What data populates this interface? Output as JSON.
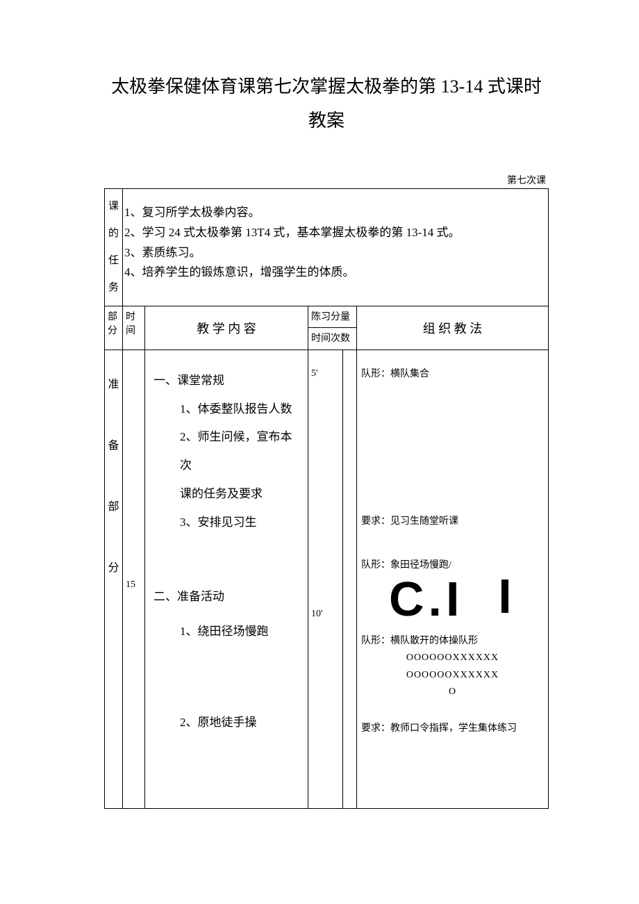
{
  "title": "太极拳保健体育课第七次掌握太极拳的第 13-14 式课时教案",
  "session_label": "第七次课",
  "row1_label": "课的任务",
  "tasks": {
    "t1": "1、复习所学太极拳内容。",
    "t2": "2、学习 24 式太极拳第 13T4 式，基本掌握太极拳的第 13-14 式。",
    "t3": "3、素质练习。",
    "t4": "4、培养学生的锻炼意识，增强学生的体质。"
  },
  "headers": {
    "part": "部分",
    "time": "时间",
    "content": "教 学 内 容",
    "volume": "陈习分量",
    "time_count": "时间次数",
    "org": "组 织 教 法"
  },
  "part_label": "准备部分",
  "time_val": "15",
  "content": {
    "s1": "一、课堂常规",
    "s1_1": "1、体委整队报告人数",
    "s1_2": "2、师生问候，宣布本次",
    "s1_2b": "课的任务及要求",
    "s1_3": "3、安排见习生",
    "s2": "二、准备活动",
    "s2_1": "1、绕田径场慢跑",
    "s2_2": "2、原地徒手操"
  },
  "marks": {
    "m1": "5'",
    "m2": "10'"
  },
  "org": {
    "o1": "队形：横队集合",
    "o2": "要求：见习生随堂听课",
    "o3": "队形：象田径场慢跑/",
    "glyph": "C.I",
    "o4": "队形：横队散开的体操队形",
    "pat1": "OOOOOOXXXXXX",
    "pat2": "OOOOOOXXXXXX",
    "pat3": "O",
    "o5": "要求：教师口令指挥，学生集体练习"
  }
}
